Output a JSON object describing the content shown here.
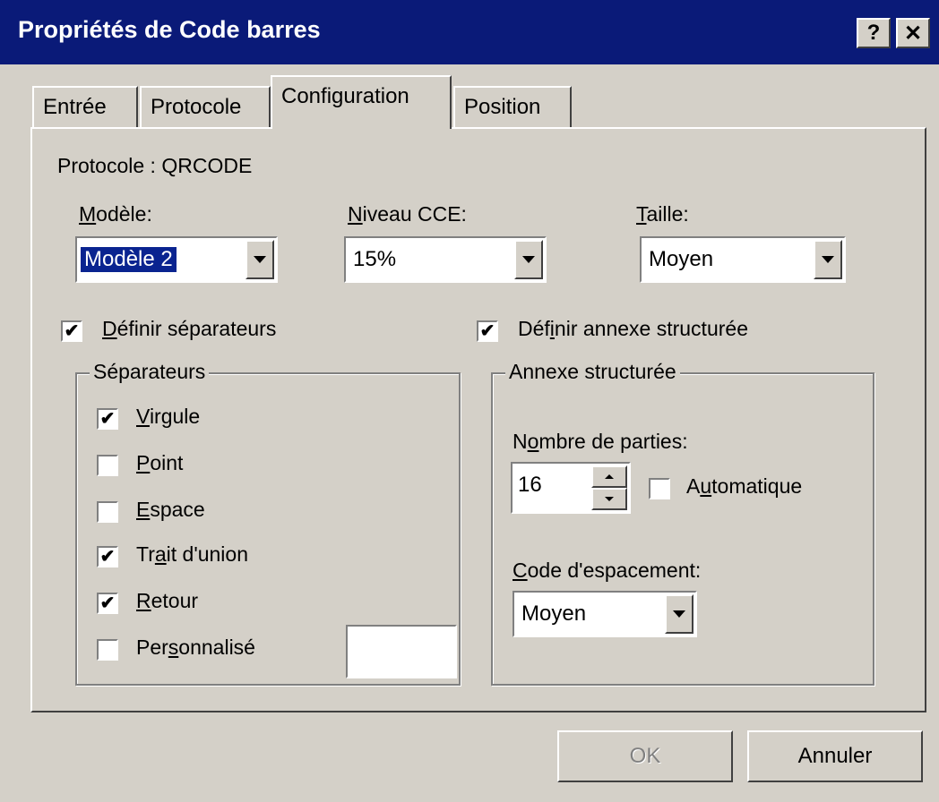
{
  "window": {
    "title": "Propriétés de Code barres",
    "help_label": "?",
    "close_label": "✕"
  },
  "tabs": [
    {
      "label": "Entrée",
      "active": false
    },
    {
      "label": "Protocole",
      "active": false
    },
    {
      "label": "Configuration",
      "active": true
    },
    {
      "label": "Position",
      "active": false
    }
  ],
  "panel": {
    "protocol_text": "Protocole : QRCODE",
    "modele": {
      "label": "Modèle:",
      "value": "Modèle 2"
    },
    "niveau": {
      "label": "Niveau CCE:",
      "value": "15%"
    },
    "taille": {
      "label": "Taille:",
      "value": "Moyen"
    },
    "def_separateurs": {
      "label": "Définir séparateurs",
      "checked": true
    },
    "def_annexe": {
      "label": "Définir annexe structurée",
      "checked": true
    },
    "separateurs": {
      "title": "Séparateurs",
      "items": [
        {
          "label": "Virgule",
          "checked": true
        },
        {
          "label": "Point",
          "checked": false
        },
        {
          "label": "Espace",
          "checked": false
        },
        {
          "label": "Trait d'union",
          "checked": true
        },
        {
          "label": "Retour",
          "checked": true
        },
        {
          "label": "Personnalisé",
          "checked": false
        }
      ],
      "custom_value": ""
    },
    "annexe": {
      "title": "Annexe structurée",
      "parties_label": "Nombre de parties:",
      "parties_value": "16",
      "auto_label": "Automatique",
      "auto_checked": false,
      "code_label": "Code d'espacement:",
      "code_value": "Moyen"
    }
  },
  "buttons": {
    "ok": "OK",
    "cancel": "Annuler"
  },
  "check_glyph": "✔"
}
